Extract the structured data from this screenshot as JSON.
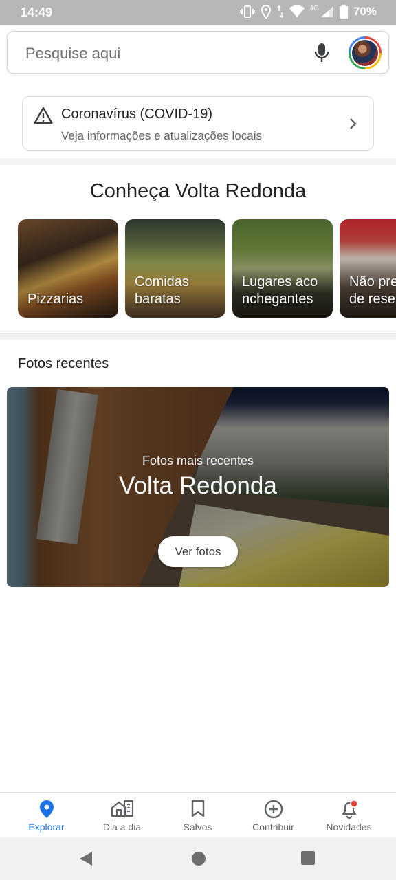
{
  "status_bar": {
    "time": "14:49",
    "network": "4G",
    "battery": "70%",
    "icons": [
      "vibrate-icon",
      "location-icon",
      "data-transfer-icon",
      "wifi-icon",
      "signal-icon",
      "battery-icon"
    ]
  },
  "search": {
    "placeholder": "Pesquise aqui",
    "icons": [
      "mic-icon",
      "avatar"
    ]
  },
  "covid": {
    "title": "Coronavírus (COVID-19)",
    "subtitle": "Veja informações e atualizações locais"
  },
  "explore": {
    "title": "Conheça Volta Redonda",
    "categories": [
      {
        "label": "Pizzarias"
      },
      {
        "label": "Comidas\nbaratas"
      },
      {
        "label": "Lugares aco\nnchegantes"
      },
      {
        "label": "Não pre\nde rese"
      }
    ]
  },
  "recent": {
    "title": "Fotos recentes",
    "banner_subtitle": "Fotos mais recentes",
    "banner_title": "Volta Redonda",
    "button_label": "Ver fotos"
  },
  "bottom_nav": {
    "active_color": "#1a73e8",
    "items": [
      {
        "label": "Explorar",
        "icon": "location-pin-icon",
        "active": true
      },
      {
        "label": "Dia a dia",
        "icon": "commute-icon",
        "active": false
      },
      {
        "label": "Salvos",
        "icon": "bookmark-icon",
        "active": false
      },
      {
        "label": "Contribuir",
        "icon": "add-circle-icon",
        "active": false
      },
      {
        "label": "Novidades",
        "icon": "notification-bell-icon",
        "active": false,
        "badge_color": "#ea4335"
      }
    ]
  },
  "system_nav": {
    "icons": [
      "back-icon",
      "home-icon",
      "recents-icon"
    ]
  }
}
